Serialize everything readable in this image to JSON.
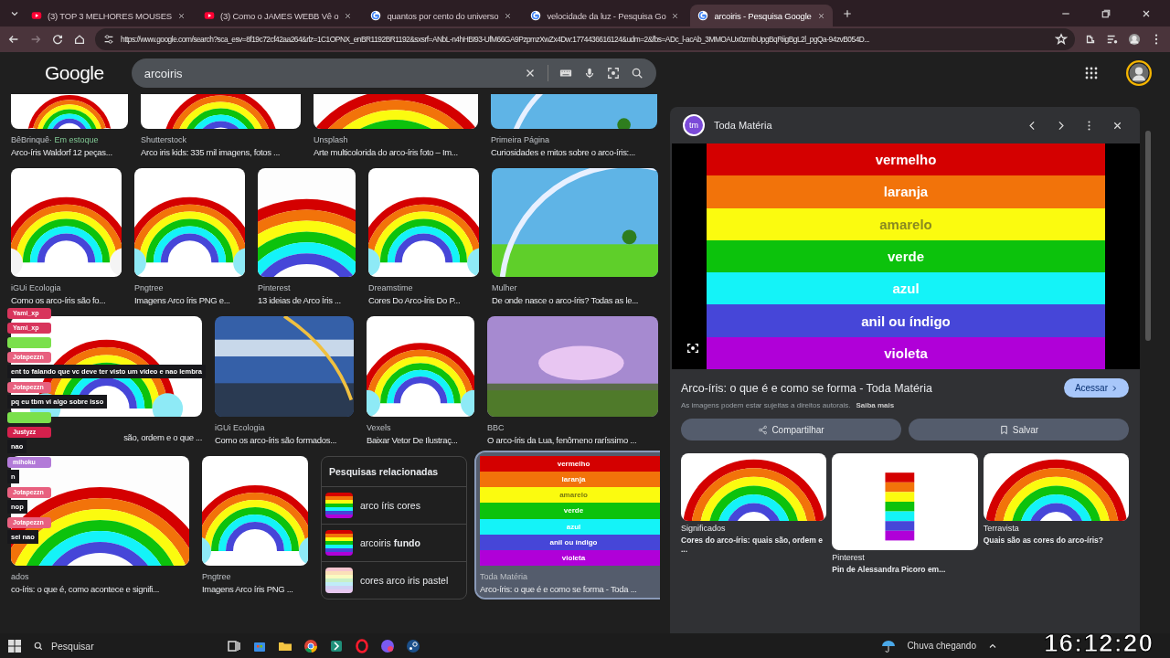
{
  "tabs": [
    {
      "title": "(3) TOP 3 MELHORES MOUSES",
      "kind": "youtube",
      "selected": false
    },
    {
      "title": "(3) Como o JAMES WEBB Vê o",
      "kind": "youtube",
      "selected": false
    },
    {
      "title": "quantos por cento do universo",
      "kind": "google",
      "selected": false
    },
    {
      "title": "velocidade da luz - Pesquisa Go",
      "kind": "google",
      "selected": false
    },
    {
      "title": "arcoiris - Pesquisa Google",
      "kind": "google",
      "selected": true
    }
  ],
  "address": "https://www.google.com/search?sca_esv=8f19c72cf42aa264&rlz=1C1OPNX_enBR1192BR1192&sxsrf=ANbL-n4hHBI93-UfM66GA9PzpmzXwZx4Dw:1774436616124&udm=2&fbs=ADc_l-acAb_3MMOAUx0zmbUpgBqRiigBgL2l_pgQa-94zvB054D...",
  "logo": "Google",
  "search": {
    "value": "arcoiris"
  },
  "rows": [
    [
      {
        "source": "BêBrinquê",
        "stock": "· Em estoque",
        "title": "Arco-íris Waldorf 12 peças...",
        "selected": false
      },
      {
        "source": "Shutterstock",
        "title": "Arco iris kids: 335 mil imagens, fotos ...",
        "selected": false
      },
      {
        "source": "Unsplash",
        "title": "Arte multicolorida do arco-íris foto – Im...",
        "selected": false
      },
      {
        "source": "Primeira Página",
        "title": "Curiosidades e mitos sobre o arco-íris:...",
        "selected": false
      }
    ],
    [
      {
        "source": "iGUi Ecologia",
        "title": "Como os arco-íris são fo...",
        "selected": false
      },
      {
        "source": "Pngtree",
        "title": "Imagens Arco íris PNG e...",
        "selected": false
      },
      {
        "source": "Pinterest",
        "title": "13 ideias de Arco Íris ...",
        "selected": false
      },
      {
        "source": "Dreamstime",
        "title": "Cores Do Arco-Íris Do P...",
        "selected": false
      },
      {
        "source": "Mulher",
        "title": "De onde nasce o arco-íris? Todas as le...",
        "selected": false
      }
    ],
    [
      {
        "title": "são, ordem e o que ...",
        "selected": false
      },
      {
        "source": "iGUi Ecologia",
        "title": "Como os arco-íris são formados...",
        "selected": false
      },
      {
        "source": "Vexels",
        "title": "Baixar Vetor De Ilustraç...",
        "selected": false
      },
      {
        "source": "BBC",
        "title": "O arco-íris da Lua, fenômeno raríssimo ...",
        "selected": false
      }
    ],
    [
      {
        "source": "ados",
        "title": "co-íris: o que é, como acontece e signifi...",
        "selected": false
      },
      {
        "source": "Pngtree",
        "title": "Imagens Arco íris PNG ...",
        "selected": false
      },
      {
        "kind": "related",
        "heading": "Pesquisas relacionadas",
        "items": [
          "arco íris cores",
          "arcoiris **fundo**",
          "cores arco iris pastel"
        ]
      },
      {
        "kind": "stripes",
        "source": "Toda Matéria",
        "title": "Arco-íris: o que é e como se forma - Toda ...",
        "selected": true,
        "stripes": [
          {
            "label": "vermelho",
            "color": "#d40000"
          },
          {
            "label": "laranja",
            "color": "#f2730a"
          },
          {
            "label": "amarelo",
            "color": "#fbfb0f"
          },
          {
            "label": "verde",
            "color": "#0cc20c"
          },
          {
            "label": "azul",
            "color": "#14f3f8"
          },
          {
            "label": "anil ou índigo",
            "color": "#4646d8"
          },
          {
            "label": "violeta",
            "color": "#b000d8"
          }
        ]
      }
    ]
  ],
  "panel": {
    "logo": "tm",
    "source": "Toda Matéria",
    "stripes": [
      {
        "label": "vermelho",
        "color": "#d40000"
      },
      {
        "label": "laranja",
        "color": "#f2730a"
      },
      {
        "label": "amarelo",
        "color": "#fbfb0f"
      },
      {
        "label": "verde",
        "color": "#0cc20c"
      },
      {
        "label": "azul",
        "color": "#14f3f8"
      },
      {
        "label": "anil ou índigo",
        "color": "#4646d8"
      },
      {
        "label": "violeta",
        "color": "#b000d8"
      }
    ],
    "title": "Arco-íris: o que é e como se forma - Toda Matéria",
    "visit": "Acessar",
    "note": "As imagens podem estar sujeitas a direitos autorais.",
    "more": "Saiba mais",
    "actions": [
      "Compartilhar",
      "Salvar"
    ],
    "related": [
      {
        "source": "Significados",
        "title": "Cores do arco-íris: quais são, ordem e ..."
      },
      {
        "source": "Pinterest",
        "title": "Pin de Alessandra Picoro em..."
      },
      {
        "source": "Terravista",
        "title": "Quais são as cores do arco-íris?"
      }
    ]
  },
  "chat": [
    {
      "user": "Yami_xp",
      "color": "#d8355c"
    },
    {
      "user": "Yami_xp",
      "color": "#d8355c"
    },
    {
      "color": "#7be04c"
    },
    {
      "user": "Jotapezzn",
      "color": "#e8607f",
      "text": "ent to falando que vc deve ter visto um video e nao lembra"
    },
    {
      "user": "Jotapezzn",
      "color": "#e8607f",
      "text": "pq eu tbm vi algo sobre isso"
    },
    {
      "color": "#7be04c"
    },
    {
      "user": "Justyzz",
      "color": "#d4204c",
      "text": "nao"
    },
    {
      "user": "mihoku",
      "color": "#b27ad8",
      "text": "n"
    },
    {
      "user": "Jotapezzn",
      "color": "#e8607f",
      "text": "nop"
    },
    {
      "user": "Jotapezzn",
      "color": "#e8607f",
      "text": "sei nao"
    }
  ],
  "taskbar": {
    "search": "Pesquisar",
    "weather": "Chuva chegando"
  },
  "clock": "16:12:20"
}
